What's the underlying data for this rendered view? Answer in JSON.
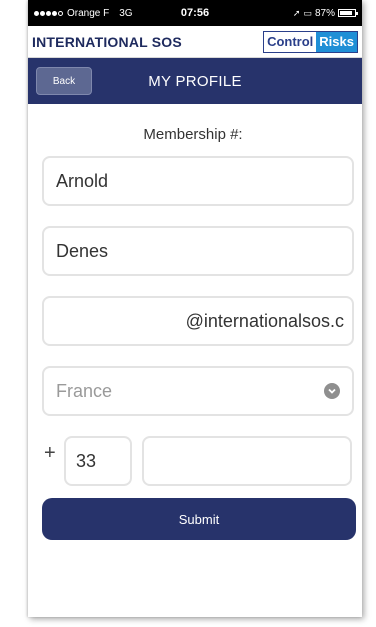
{
  "status_bar": {
    "carrier": "Orange F",
    "network": "3G",
    "time": "07:56",
    "battery": "87%",
    "battery_level": 0.87
  },
  "brand": {
    "left_logo": "INTERNATIONAL SOS",
    "right_logo_part1": "Control",
    "right_logo_part2": "Risks"
  },
  "nav": {
    "back_label": "Back",
    "title": "MY PROFILE"
  },
  "form": {
    "membership_label": "Membership #:",
    "first_name": "Arnold",
    "last_name": "Denes",
    "email": "@internationalsos.c",
    "country_placeholder": "France",
    "phone_prefix": "+",
    "country_code": "33",
    "phone_number": "",
    "submit_label": "Submit"
  },
  "colors": {
    "nav_bg": "#27336b",
    "brand_navy": "#1e2a5e",
    "brand_blue": "#1f8fd6"
  }
}
